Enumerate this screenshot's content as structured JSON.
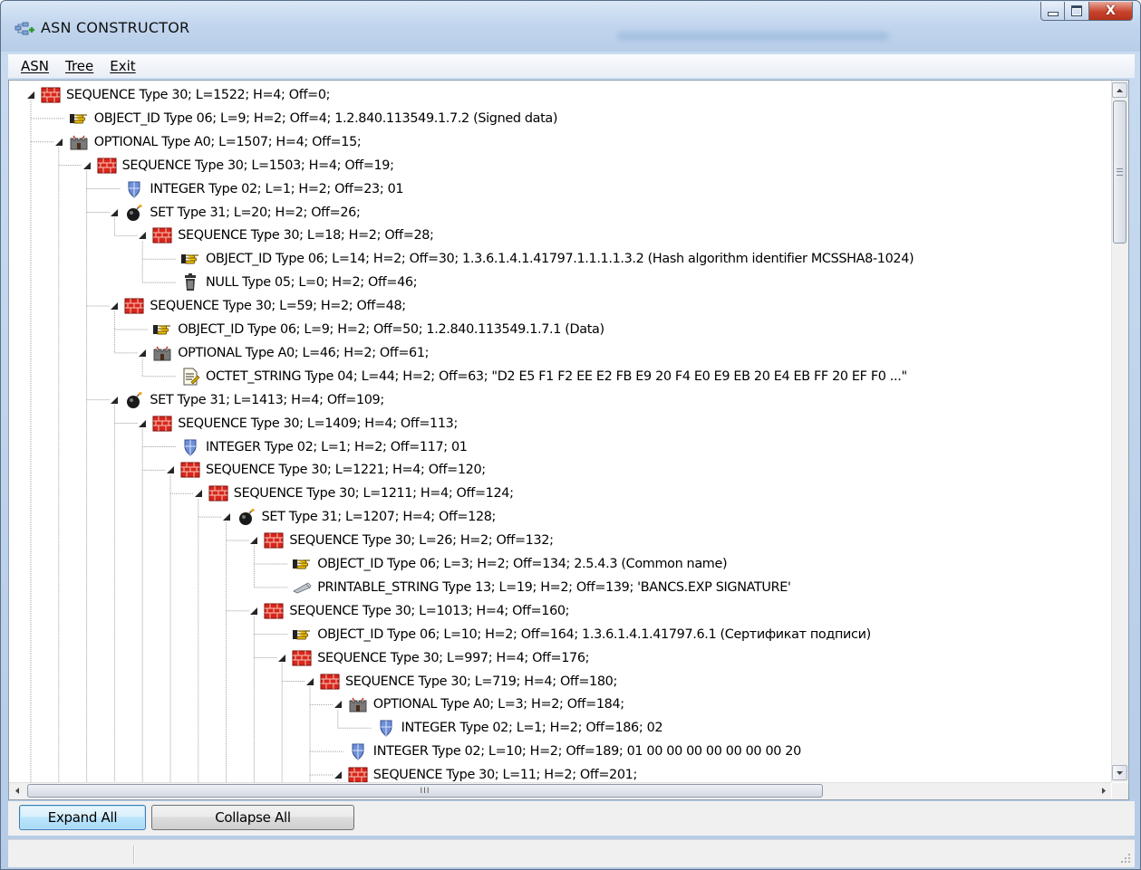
{
  "window": {
    "title": "ASN CONSTRUCTOR"
  },
  "menu": [
    "ASN",
    "Tree",
    "Exit"
  ],
  "icons": {
    "sequence": "red-bricks-icon",
    "object_id": "pointing-hand-icon",
    "optional": "castle-icon",
    "integer": "shield-icon",
    "set": "bomb-icon",
    "null": "trash-can-icon",
    "octet_string": "document-icon",
    "printable_string": "pen-icon"
  },
  "tree": [
    {
      "depth": 0,
      "expander": "open",
      "icon": "sequence",
      "text": "SEQUENCE Type 30; L=1522; H=4;  Off=0;"
    },
    {
      "depth": 1,
      "expander": "none",
      "icon": "object_id",
      "text": "OBJECT_ID Type 06; L=9; H=2;  Off=4;  1.2.840.113549.1.7.2 (Signed data)"
    },
    {
      "depth": 1,
      "expander": "open",
      "icon": "optional",
      "text": "OPTIONAL Type A0; L=1507; H=4;  Off=15;"
    },
    {
      "depth": 2,
      "expander": "open",
      "icon": "sequence",
      "text": "SEQUENCE Type 30; L=1503; H=4;  Off=19;"
    },
    {
      "depth": 3,
      "expander": "none",
      "icon": "integer",
      "text": "INTEGER Type 02; L=1; H=2;  Off=23;  01"
    },
    {
      "depth": 3,
      "expander": "open",
      "icon": "set",
      "text": "SET Type 31; L=20; H=2;  Off=26;"
    },
    {
      "depth": 4,
      "expander": "open",
      "icon": "sequence",
      "text": "SEQUENCE Type 30; L=18; H=2;  Off=28;"
    },
    {
      "depth": 5,
      "expander": "none",
      "icon": "object_id",
      "text": "OBJECT_ID Type 06; L=14; H=2;  Off=30;  1.3.6.1.4.1.41797.1.1.1.1.3.2 (Hash algorithm identifier MCSSHA8-1024)"
    },
    {
      "depth": 5,
      "expander": "none",
      "icon": "null",
      "text": "NULL Type 05; L=0; H=2;  Off=46;"
    },
    {
      "depth": 3,
      "expander": "open",
      "icon": "sequence",
      "text": "SEQUENCE Type 30; L=59; H=2;  Off=48;"
    },
    {
      "depth": 4,
      "expander": "none",
      "icon": "object_id",
      "text": "OBJECT_ID Type 06; L=9; H=2;  Off=50;  1.2.840.113549.1.7.1 (Data)"
    },
    {
      "depth": 4,
      "expander": "open",
      "icon": "optional",
      "text": "OPTIONAL Type A0; L=46; H=2;  Off=61;"
    },
    {
      "depth": 5,
      "expander": "none",
      "icon": "octet_string",
      "text": "OCTET_STRING Type 04; L=44; H=2;  Off=63;  \"D2 E5 F1 F2 EE E2 FB E9 20 F4 E0 E9 EB 20 E4 EB FF 20 EF F0 ...\""
    },
    {
      "depth": 3,
      "expander": "open",
      "icon": "set",
      "text": "SET Type 31; L=1413; H=4;  Off=109;"
    },
    {
      "depth": 4,
      "expander": "open",
      "icon": "sequence",
      "text": "SEQUENCE Type 30; L=1409; H=4;  Off=113;"
    },
    {
      "depth": 5,
      "expander": "none",
      "icon": "integer",
      "text": "INTEGER Type 02; L=1; H=2;  Off=117;  01"
    },
    {
      "depth": 5,
      "expander": "open",
      "icon": "sequence",
      "text": "SEQUENCE Type 30; L=1221; H=4;  Off=120;"
    },
    {
      "depth": 6,
      "expander": "open",
      "icon": "sequence",
      "text": "SEQUENCE Type 30; L=1211; H=4;  Off=124;"
    },
    {
      "depth": 7,
      "expander": "open",
      "icon": "set",
      "text": "SET Type 31; L=1207; H=4;  Off=128;"
    },
    {
      "depth": 8,
      "expander": "open",
      "icon": "sequence",
      "text": "SEQUENCE Type 30; L=26; H=2;  Off=132;"
    },
    {
      "depth": 9,
      "expander": "none",
      "icon": "object_id",
      "text": "OBJECT_ID Type 06; L=3; H=2;  Off=134;  2.5.4.3 (Common name)"
    },
    {
      "depth": 9,
      "expander": "none",
      "icon": "printable_string",
      "text": "PRINTABLE_STRING Type 13; L=19; H=2;  Off=139;  'BANCS.EXP SIGNATURE'"
    },
    {
      "depth": 8,
      "expander": "open",
      "icon": "sequence",
      "text": "SEQUENCE Type 30; L=1013; H=4;  Off=160;"
    },
    {
      "depth": 9,
      "expander": "none",
      "icon": "object_id",
      "text": "OBJECT_ID Type 06; L=10; H=2;  Off=164;  1.3.6.1.4.1.41797.6.1  (Сертификат подписи)"
    },
    {
      "depth": 9,
      "expander": "open",
      "icon": "sequence",
      "text": "SEQUENCE Type 30; L=997; H=4;  Off=176;"
    },
    {
      "depth": 10,
      "expander": "open",
      "icon": "sequence",
      "text": "SEQUENCE Type 30; L=719; H=4;  Off=180;"
    },
    {
      "depth": 11,
      "expander": "open",
      "icon": "optional",
      "text": "OPTIONAL Type A0; L=3; H=2;  Off=184;"
    },
    {
      "depth": 12,
      "expander": "none",
      "icon": "integer",
      "text": "INTEGER Type 02; L=1; H=2;  Off=186;  02"
    },
    {
      "depth": 11,
      "expander": "none",
      "icon": "integer",
      "text": "INTEGER Type 02; L=10; H=2;  Off=189;  01 00 00 00 00 00 00 00 20"
    },
    {
      "depth": 11,
      "expander": "open",
      "icon": "sequence",
      "text": "SEQUENCE Type 30; L=11; H=2;  Off=201;"
    }
  ],
  "buttons": {
    "expand_all": "Expand All",
    "collapse_all": "Collapse All"
  },
  "hscroll_thumb_glyph": "III",
  "colors": {
    "brick": "#d9261c",
    "hand": "#f2c200",
    "castle": "#7a7a7a",
    "shield": "#6f8fd8",
    "bomb": "#1a1a1a",
    "focus_border": "#3c7fb1"
  }
}
